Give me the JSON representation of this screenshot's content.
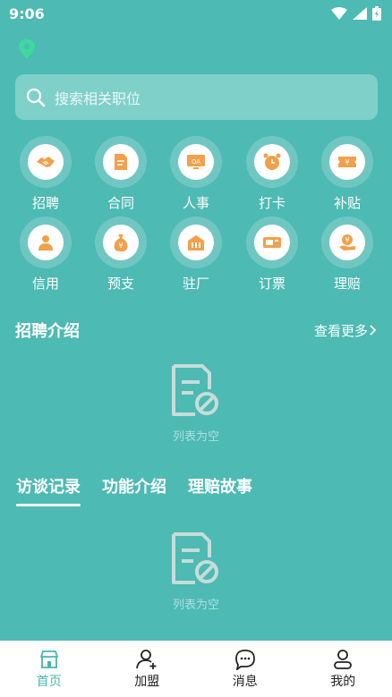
{
  "status_bar": {
    "time": "9:06"
  },
  "search": {
    "placeholder": "搜索相关职位"
  },
  "quick_actions": [
    {
      "label": "招聘",
      "icon": "handshake-icon"
    },
    {
      "label": "合同",
      "icon": "document-icon"
    },
    {
      "label": "人事",
      "icon": "oa-board-icon"
    },
    {
      "label": "打卡",
      "icon": "alarm-clock-icon"
    },
    {
      "label": "补贴",
      "icon": "ticket-icon"
    },
    {
      "label": "信用",
      "icon": "person-card-icon"
    },
    {
      "label": "预支",
      "icon": "money-bag-icon"
    },
    {
      "label": "驻厂",
      "icon": "factory-icon"
    },
    {
      "label": "订票",
      "icon": "train-ticket-icon"
    },
    {
      "label": "理赔",
      "icon": "hand-coin-icon"
    }
  ],
  "recruit_section": {
    "title": "招聘介绍",
    "more": "查看更多"
  },
  "empty": {
    "text1": "列表为空",
    "text2": "列表为空"
  },
  "tabs": [
    {
      "label": "访谈记录",
      "active": true
    },
    {
      "label": "功能介绍",
      "active": false
    },
    {
      "label": "理赔故事",
      "active": false
    }
  ],
  "bottom_nav": [
    {
      "label": "首页",
      "icon": "home-icon",
      "active": true
    },
    {
      "label": "加盟",
      "icon": "add-user-icon",
      "active": false
    },
    {
      "label": "消息",
      "icon": "message-icon",
      "active": false
    },
    {
      "label": "我的",
      "icon": "profile-icon",
      "active": false
    }
  ],
  "colors": {
    "background": "#4dbab3",
    "accent": "#f2a04a",
    "active_nav": "#49b6ae"
  }
}
